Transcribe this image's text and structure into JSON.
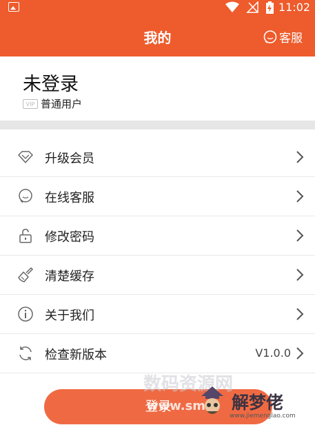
{
  "status_bar": {
    "time": "11:02"
  },
  "header": {
    "title": "我的",
    "cs_label": "客服"
  },
  "profile": {
    "name": "未登录",
    "level": "普通用户",
    "badge": "VIP"
  },
  "menu": [
    {
      "label": "升级会员",
      "icon": "diamond-icon"
    },
    {
      "label": "在线客服",
      "icon": "chat-icon"
    },
    {
      "label": "修改密码",
      "icon": "lock-icon"
    },
    {
      "label": "清楚缓存",
      "icon": "brush-icon"
    },
    {
      "label": "关于我们",
      "icon": "info-icon"
    },
    {
      "label": "检查新版本",
      "icon": "refresh-icon",
      "value": "V1.0.0"
    }
  ],
  "login": {
    "label": "登录"
  },
  "watermark": {
    "line1": "数码资源网",
    "line2": "www.sm",
    "site_name": "解梦佬",
    "site_url": "www.jiemenglao.com"
  },
  "colors": {
    "brand": "#ee5b2c",
    "login_button": "#ef6a43",
    "divider": "#e6e6e6"
  }
}
